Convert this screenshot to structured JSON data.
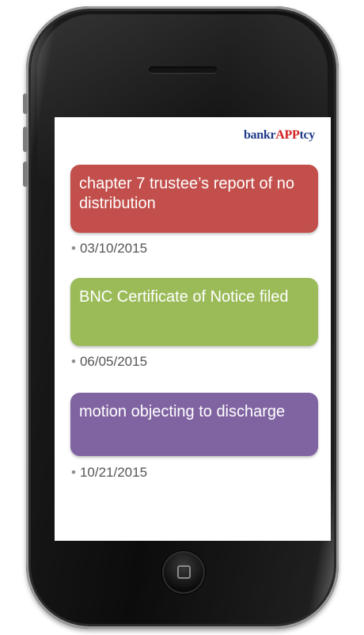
{
  "brand": {
    "part1": "bankr",
    "part2": "APP",
    "part3": "tcy"
  },
  "events": [
    {
      "title": "chapter 7 trustee’s report of no distribution",
      "date": "03/10/2015",
      "color": "#c24f4b"
    },
    {
      "title": "BNC Certificate of Notice filed",
      "date": "06/05/2015",
      "color": "#9bbb59"
    },
    {
      "title": "motion objecting to discharge",
      "date": "10/21/2015",
      "color": "#8064a2"
    }
  ],
  "icons": {
    "bullet": "•",
    "home": "home-button-icon",
    "speaker": "speaker-icon"
  }
}
